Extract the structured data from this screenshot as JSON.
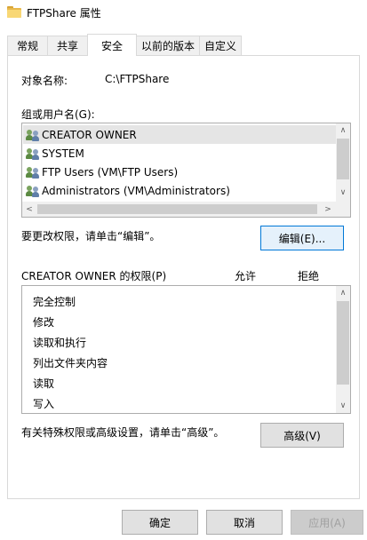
{
  "window": {
    "title": "FTPShare 属性",
    "icon": "folder-icon"
  },
  "tabs": [
    {
      "label": "常规"
    },
    {
      "label": "共享"
    },
    {
      "label": "安全",
      "active": true
    },
    {
      "label": "以前的版本"
    },
    {
      "label": "自定义"
    }
  ],
  "security": {
    "object_name_label": "对象名称:",
    "object_name_value": "C:\\FTPShare",
    "groups_label": "组或用户名(G):",
    "users": [
      {
        "name": "CREATOR OWNER",
        "selected": true
      },
      {
        "name": "SYSTEM"
      },
      {
        "name": "FTP Users (VM\\FTP Users)"
      },
      {
        "name": "Administrators (VM\\Administrators)"
      }
    ],
    "change_hint": "要更改权限，请单击“编辑”。",
    "edit_button": "编辑(E)...",
    "perm_header": "CREATOR OWNER 的权限(P)",
    "allow_header": "允许",
    "deny_header": "拒绝",
    "permissions": [
      "完全控制",
      "修改",
      "读取和执行",
      "列出文件夹内容",
      "读取",
      "写入"
    ],
    "advanced_hint": "有关特殊权限或高级设置，请单击“高级”。",
    "advanced_button": "高级(V)"
  },
  "footer": {
    "ok_button": "确定",
    "cancel_button": "取消",
    "apply_button": "应用(A)"
  },
  "colors": {
    "focus_border": "#0078d7",
    "selection": "#e5e5e5"
  }
}
